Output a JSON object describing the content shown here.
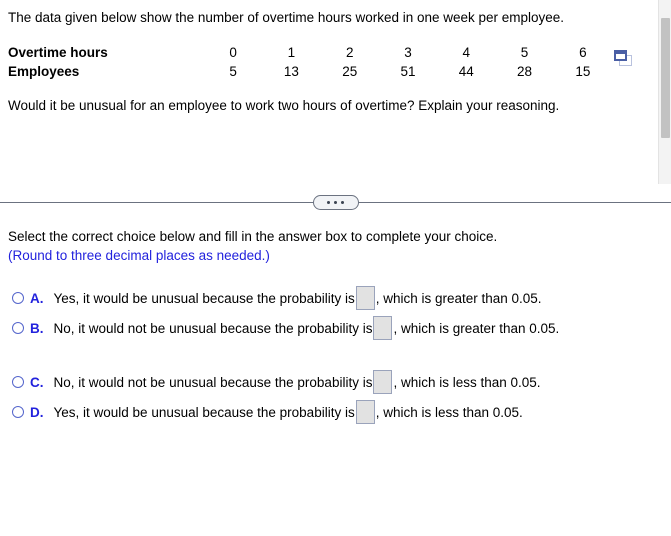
{
  "problem": {
    "prompt": "The data given below show the number of overtime hours worked in one week per employee.",
    "table": {
      "row_labels": [
        "Overtime hours",
        "Employees"
      ],
      "overtime_hours": [
        "0",
        "1",
        "2",
        "3",
        "4",
        "5",
        "6"
      ],
      "employees": [
        "5",
        "13",
        "25",
        "51",
        "44",
        "28",
        "15"
      ]
    },
    "copy_icon_name": "copy-table-icon",
    "question": "Would it be unusual for an employee to work two hours of overtime? Explain your reasoning."
  },
  "divider": {
    "dots": [
      "•",
      "•",
      "•"
    ]
  },
  "answer_section": {
    "instruction": "Select the correct choice below and fill in the answer box to complete your choice.",
    "round_note": "(Round to three decimal places as needed.)",
    "options": [
      {
        "letter": "A.",
        "text_before": "Yes, it would be unusual because the probability is",
        "value": "",
        "text_after": ", which is greater than 0.05."
      },
      {
        "letter": "B.",
        "text_before": "No, it would not be unusual because the probability is",
        "value": "",
        "text_after": ", which is greater than 0.05."
      },
      {
        "letter": "C.",
        "text_before": "No, it would not be unusual because the probability is",
        "value": "",
        "text_after": ", which is less than 0.05."
      },
      {
        "letter": "D.",
        "text_before": "Yes, it would be unusual because the probability is",
        "value": "",
        "text_after": ", which is less than 0.05."
      }
    ]
  },
  "colors": {
    "link_blue": "#2222dd",
    "radio_blue": "#5566cc",
    "divider_gray": "#6b7280",
    "answer_box_fill": "#e2e2e2"
  }
}
